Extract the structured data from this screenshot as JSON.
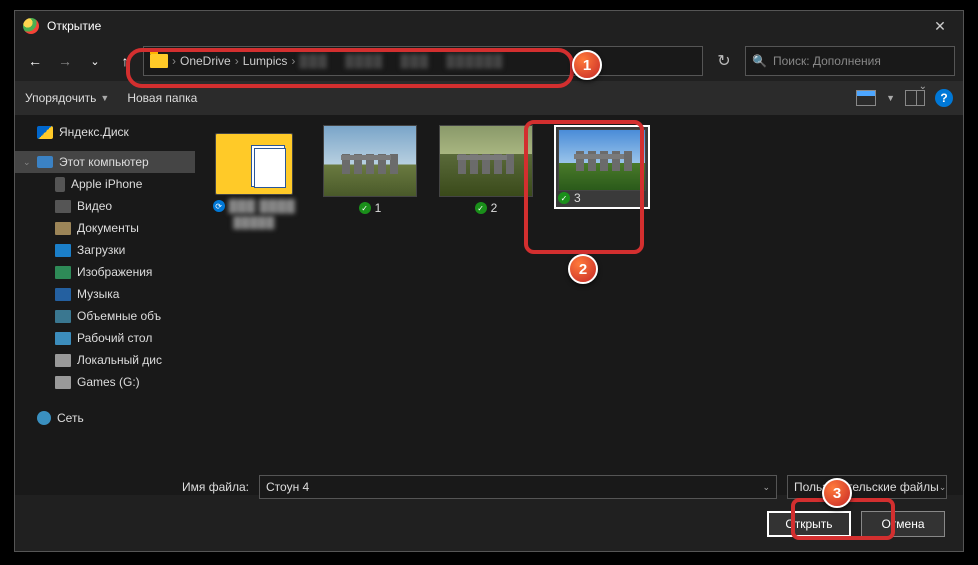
{
  "title": "Открытие",
  "nav": {
    "back": "←",
    "forward": "→",
    "up": "↑"
  },
  "breadcrumb": [
    "OneDrive",
    "Lumpics"
  ],
  "search": {
    "placeholder": "Поиск: Дополнения"
  },
  "refresh_icon": "↻",
  "toolbar": {
    "organize": "Упорядочить",
    "newfolder": "Новая папка"
  },
  "sidebar": [
    {
      "label": "Яндекс.Диск",
      "icon": "yadisk",
      "level": 1
    },
    {
      "label": "Этот компьютер",
      "icon": "pc",
      "level": 1,
      "selected": true,
      "expand": true
    },
    {
      "label": "Apple iPhone",
      "icon": "phone",
      "level": 2
    },
    {
      "label": "Видео",
      "icon": "video",
      "level": 2
    },
    {
      "label": "Документы",
      "icon": "doc",
      "level": 2
    },
    {
      "label": "Загрузки",
      "icon": "down",
      "level": 2
    },
    {
      "label": "Изображения",
      "icon": "img",
      "level": 2
    },
    {
      "label": "Музыка",
      "icon": "music",
      "level": 2
    },
    {
      "label": "Объемные объ",
      "icon": "obj",
      "level": 2
    },
    {
      "label": "Рабочий стол",
      "icon": "desk",
      "level": 2
    },
    {
      "label": "Локальный дис",
      "icon": "disk",
      "level": 2
    },
    {
      "label": "Games (G:)",
      "icon": "disk",
      "level": 2
    },
    {
      "label": "Сеть",
      "icon": "net",
      "level": 1
    }
  ],
  "items": [
    {
      "name": "",
      "type": "folder",
      "sync": "arrows",
      "blurred": true
    },
    {
      "name": "1",
      "type": "image",
      "variant": "sh1",
      "sync": "ok"
    },
    {
      "name": "2",
      "type": "image",
      "variant": "sh2",
      "sync": "ok"
    },
    {
      "name": "3",
      "type": "image",
      "variant": "sh3",
      "sync": "ok",
      "selected": true
    }
  ],
  "footer": {
    "filename_label": "Имя файла:",
    "filename_value": "Стоун 4",
    "filter_value": "Пользовательские файлы",
    "open": "Открыть",
    "cancel": "Отмена"
  },
  "callouts": {
    "n1": "1",
    "n2": "2",
    "n3": "3"
  }
}
